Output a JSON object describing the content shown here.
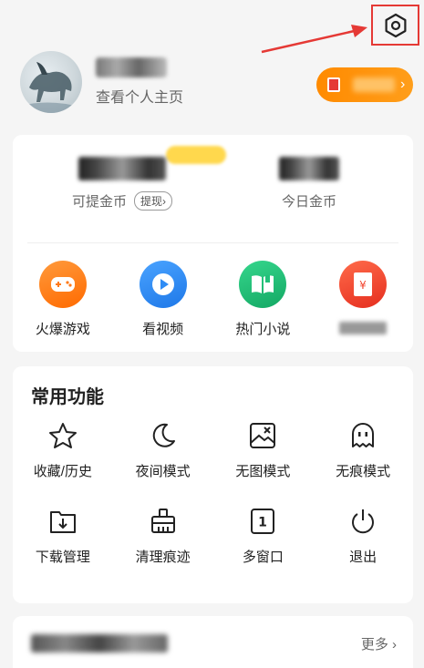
{
  "profile": {
    "view_homepage": "查看个人主页"
  },
  "stats": {
    "withdrawable_label": "可提金币",
    "withdraw_button": "提现",
    "withdraw_chevron": "›",
    "today_label": "今日金币"
  },
  "quick_actions": [
    {
      "label": "火爆游戏",
      "icon": "gamepad-icon",
      "color": "#ff7a1a"
    },
    {
      "label": "看视频",
      "icon": "play-icon",
      "color": "#2f8cf5"
    },
    {
      "label": "热门小说",
      "icon": "book-icon",
      "color": "#22c07a"
    },
    {
      "label": "",
      "icon": "red-envelope-icon",
      "color": "#f2452f"
    }
  ],
  "features": {
    "title": "常用功能",
    "items": [
      {
        "label": "收藏/历史",
        "icon": "star-icon"
      },
      {
        "label": "夜间模式",
        "icon": "moon-icon"
      },
      {
        "label": "无图模式",
        "icon": "no-image-icon"
      },
      {
        "label": "无痕模式",
        "icon": "ghost-icon"
      },
      {
        "label": "下载管理",
        "icon": "download-icon"
      },
      {
        "label": "清理痕迹",
        "icon": "broom-icon"
      },
      {
        "label": "多窗口",
        "icon": "multi-window-icon",
        "badge": "1"
      },
      {
        "label": "退出",
        "icon": "power-icon"
      }
    ]
  },
  "games_section": {
    "more_label": "更多"
  },
  "coin_pill": {
    "chevron": "›"
  }
}
